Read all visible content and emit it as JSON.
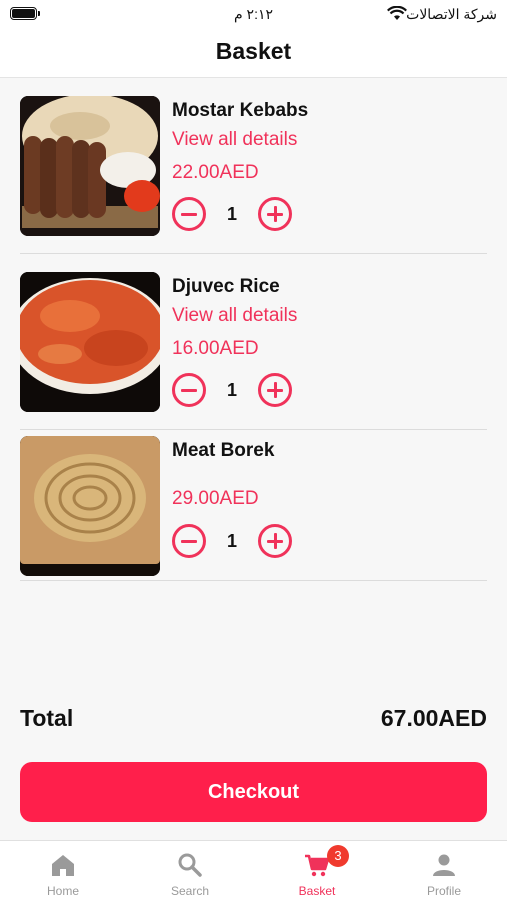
{
  "status_bar": {
    "time": "٢:١٢ م",
    "carrier": "شركة الاتصالات"
  },
  "header": {
    "title": "Basket"
  },
  "basket": {
    "items": [
      {
        "name": "Mostar Kebabs",
        "details_link": "View all details",
        "price": "22.00AED",
        "quantity": "1"
      },
      {
        "name": "Djuvec Rice",
        "details_link": "View all details",
        "price": "16.00AED",
        "quantity": "1"
      },
      {
        "name": "Meat Borek",
        "price": "29.00AED",
        "quantity": "1"
      }
    ]
  },
  "summary": {
    "total_label": "Total",
    "total_value": "67.00AED"
  },
  "checkout": {
    "label": "Checkout"
  },
  "tabbar": {
    "tabs": [
      {
        "label": "Home",
        "icon": "home-icon"
      },
      {
        "label": "Search",
        "icon": "search-icon"
      },
      {
        "label": "Basket",
        "icon": "cart-icon",
        "badge": "3",
        "active": true
      },
      {
        "label": "Profile",
        "icon": "person-icon"
      }
    ]
  },
  "colors": {
    "accent": "#f0325a",
    "button": "#ff1f4b",
    "badge": "#f03a2e",
    "inactive": "#9a9a9a"
  }
}
